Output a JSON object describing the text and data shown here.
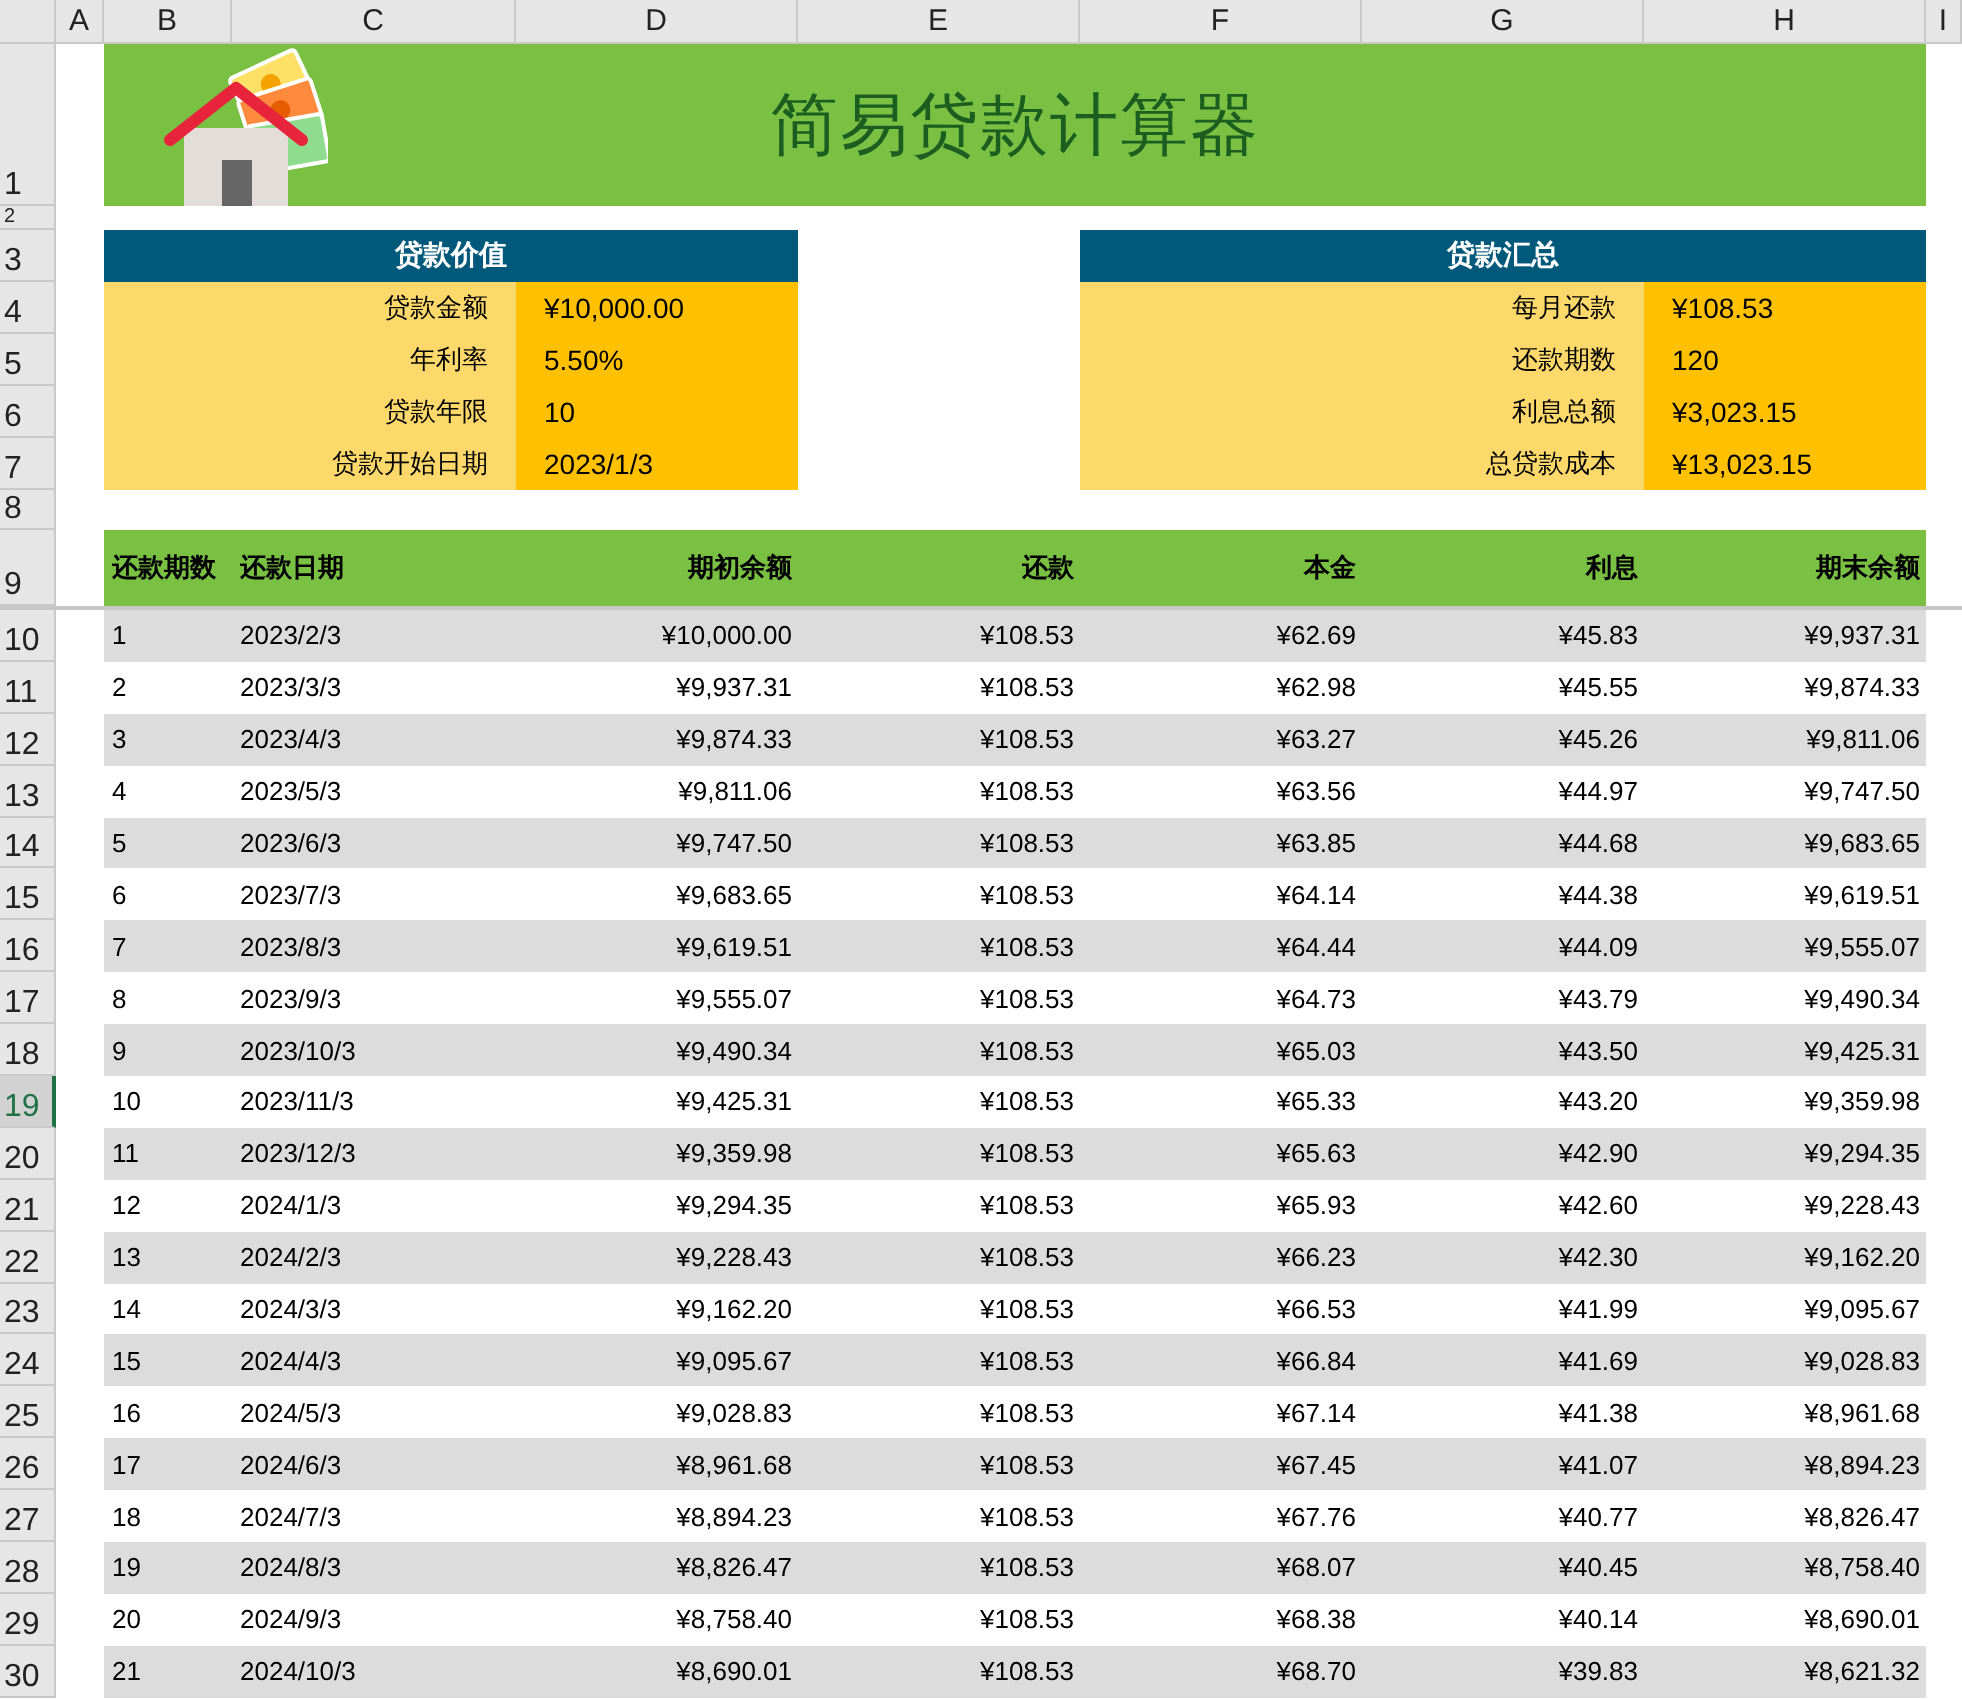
{
  "column_headers": [
    {
      "label": "A"
    },
    {
      "label": "B"
    },
    {
      "label": "C"
    },
    {
      "label": "D"
    },
    {
      "label": "E"
    },
    {
      "label": "F"
    },
    {
      "label": "G"
    },
    {
      "label": "H"
    },
    {
      "label": "I"
    }
  ],
  "row_headers": [
    {
      "label": "1",
      "selected": false
    },
    {
      "label": "2",
      "selected": false
    },
    {
      "label": "3",
      "selected": false
    },
    {
      "label": "4",
      "selected": false
    },
    {
      "label": "5",
      "selected": false
    },
    {
      "label": "6",
      "selected": false
    },
    {
      "label": "7",
      "selected": false
    },
    {
      "label": "8",
      "selected": false
    },
    {
      "label": "9",
      "selected": false
    },
    {
      "label": "10",
      "selected": false
    },
    {
      "label": "11",
      "selected": false
    },
    {
      "label": "12",
      "selected": false
    },
    {
      "label": "13",
      "selected": false
    },
    {
      "label": "14",
      "selected": false
    },
    {
      "label": "15",
      "selected": false
    },
    {
      "label": "16",
      "selected": false
    },
    {
      "label": "17",
      "selected": false
    },
    {
      "label": "18",
      "selected": false
    },
    {
      "label": "19",
      "selected": true
    },
    {
      "label": "20",
      "selected": false
    },
    {
      "label": "21",
      "selected": false
    },
    {
      "label": "22",
      "selected": false
    },
    {
      "label": "23",
      "selected": false
    },
    {
      "label": "24",
      "selected": false
    },
    {
      "label": "25",
      "selected": false
    },
    {
      "label": "26",
      "selected": false
    },
    {
      "label": "27",
      "selected": false
    },
    {
      "label": "28",
      "selected": false
    },
    {
      "label": "29",
      "selected": false
    },
    {
      "label": "30",
      "selected": false
    }
  ],
  "title": "简易贷款计算器",
  "loan_values": {
    "heading": "贷款价值",
    "fields": [
      {
        "label": "贷款金额",
        "value": "¥10,000.00"
      },
      {
        "label": "年利率",
        "value": "5.50%"
      },
      {
        "label": "贷款年限",
        "value": "10"
      },
      {
        "label": "贷款开始日期",
        "value": "2023/1/3"
      }
    ]
  },
  "loan_summary": {
    "heading": "贷款汇总",
    "fields": [
      {
        "label": "每月还款",
        "value": "¥108.53"
      },
      {
        "label": "还款期数",
        "value": "120"
      },
      {
        "label": "利息总额",
        "value": "¥3,023.15"
      },
      {
        "label": "总贷款成本",
        "value": "¥13,023.15"
      }
    ]
  },
  "table": {
    "columns": [
      "还款期数",
      "还款日期",
      "期初余额",
      "还款",
      "本金",
      "利息",
      "期末余额"
    ],
    "rows": [
      [
        "1",
        "2023/2/3",
        "¥10,000.00",
        "¥108.53",
        "¥62.69",
        "¥45.83",
        "¥9,937.31"
      ],
      [
        "2",
        "2023/3/3",
        "¥9,937.31",
        "¥108.53",
        "¥62.98",
        "¥45.55",
        "¥9,874.33"
      ],
      [
        "3",
        "2023/4/3",
        "¥9,874.33",
        "¥108.53",
        "¥63.27",
        "¥45.26",
        "¥9,811.06"
      ],
      [
        "4",
        "2023/5/3",
        "¥9,811.06",
        "¥108.53",
        "¥63.56",
        "¥44.97",
        "¥9,747.50"
      ],
      [
        "5",
        "2023/6/3",
        "¥9,747.50",
        "¥108.53",
        "¥63.85",
        "¥44.68",
        "¥9,683.65"
      ],
      [
        "6",
        "2023/7/3",
        "¥9,683.65",
        "¥108.53",
        "¥64.14",
        "¥44.38",
        "¥9,619.51"
      ],
      [
        "7",
        "2023/8/3",
        "¥9,619.51",
        "¥108.53",
        "¥64.44",
        "¥44.09",
        "¥9,555.07"
      ],
      [
        "8",
        "2023/9/3",
        "¥9,555.07",
        "¥108.53",
        "¥64.73",
        "¥43.79",
        "¥9,490.34"
      ],
      [
        "9",
        "2023/10/3",
        "¥9,490.34",
        "¥108.53",
        "¥65.03",
        "¥43.50",
        "¥9,425.31"
      ],
      [
        "10",
        "2023/11/3",
        "¥9,425.31",
        "¥108.53",
        "¥65.33",
        "¥43.20",
        "¥9,359.98"
      ],
      [
        "11",
        "2023/12/3",
        "¥9,359.98",
        "¥108.53",
        "¥65.63",
        "¥42.90",
        "¥9,294.35"
      ],
      [
        "12",
        "2024/1/3",
        "¥9,294.35",
        "¥108.53",
        "¥65.93",
        "¥42.60",
        "¥9,228.43"
      ],
      [
        "13",
        "2024/2/3",
        "¥9,228.43",
        "¥108.53",
        "¥66.23",
        "¥42.30",
        "¥9,162.20"
      ],
      [
        "14",
        "2024/3/3",
        "¥9,162.20",
        "¥108.53",
        "¥66.53",
        "¥41.99",
        "¥9,095.67"
      ],
      [
        "15",
        "2024/4/3",
        "¥9,095.67",
        "¥108.53",
        "¥66.84",
        "¥41.69",
        "¥9,028.83"
      ],
      [
        "16",
        "2024/5/3",
        "¥9,028.83",
        "¥108.53",
        "¥67.14",
        "¥41.38",
        "¥8,961.68"
      ],
      [
        "17",
        "2024/6/3",
        "¥8,961.68",
        "¥108.53",
        "¥67.45",
        "¥41.07",
        "¥8,894.23"
      ],
      [
        "18",
        "2024/7/3",
        "¥8,894.23",
        "¥108.53",
        "¥67.76",
        "¥40.77",
        "¥8,826.47"
      ],
      [
        "19",
        "2024/8/3",
        "¥8,826.47",
        "¥108.53",
        "¥68.07",
        "¥40.45",
        "¥8,758.40"
      ],
      [
        "20",
        "2024/9/3",
        "¥8,758.40",
        "¥108.53",
        "¥68.38",
        "¥40.14",
        "¥8,690.01"
      ],
      [
        "21",
        "2024/10/3",
        "¥8,690.01",
        "¥108.53",
        "¥68.70",
        "¥39.83",
        "¥8,621.32"
      ]
    ]
  }
}
